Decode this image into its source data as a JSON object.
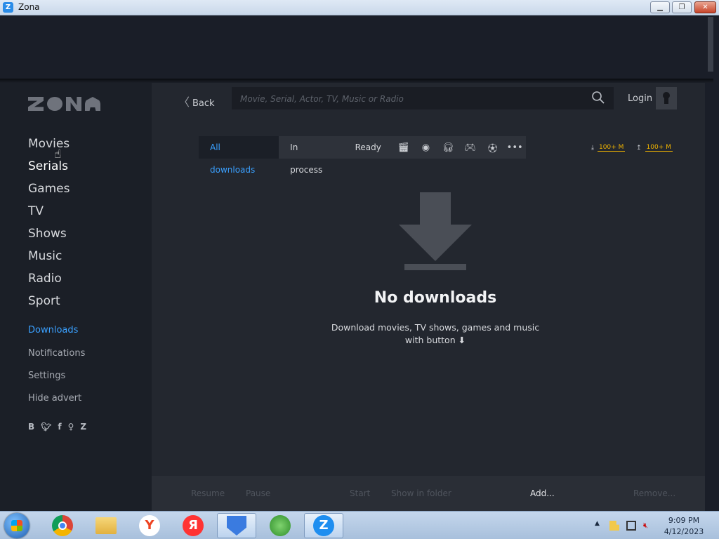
{
  "window": {
    "title": "Zona"
  },
  "sidebar": {
    "main_items": [
      "Movies",
      "Serials",
      "Games",
      "TV",
      "Shows",
      "Music",
      "Radio",
      "Sport"
    ],
    "sub_items": [
      "Downloads",
      "Notifications",
      "Settings",
      "Hide advert"
    ],
    "social": [
      "B",
      "twitter",
      "f",
      "ok",
      "zona"
    ]
  },
  "header": {
    "back_label": "Back",
    "search_placeholder": "Movie, Serial, Actor, TV, Music or Radio",
    "search_value": "",
    "login_label": "Login"
  },
  "filters": {
    "tabs": [
      "All downloads",
      "In process",
      "Ready"
    ],
    "active_tab": "All downloads",
    "icons": [
      "movies-icon",
      "serials-icon",
      "music-icon",
      "games-icon",
      "sport-icon",
      "more-icon"
    ]
  },
  "speed": {
    "download": "100+ M",
    "upload": "100+ M"
  },
  "empty_state": {
    "title": "No downloads",
    "description_line1": "Download movies, TV shows, games and music",
    "description_line2": "with button"
  },
  "bottom_bar": {
    "resume": "Resume",
    "pause": "Pause",
    "start": "Start",
    "show_in_folder": "Show in folder",
    "add": "Add...",
    "remove": "Remove..."
  },
  "taskbar": {
    "time": "9:09 PM",
    "date": "4/12/2023"
  }
}
